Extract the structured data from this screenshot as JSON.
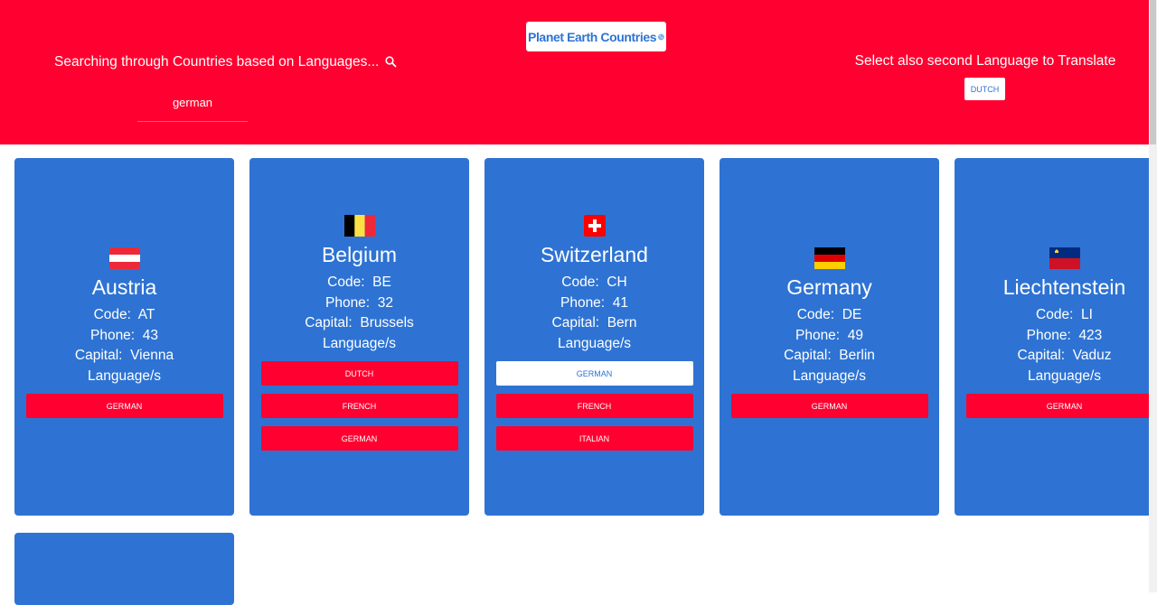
{
  "header": {
    "logo_text": "Planet Earth Countries",
    "search_title": "Searching through Countries based on Languages...",
    "search_value": "german",
    "translate_title": "Select also second Language to Translate",
    "translate_button": "DUTCH"
  },
  "labels": {
    "code": "Code:",
    "phone": "Phone:",
    "capital": "Capital:",
    "languages": "Language/s"
  },
  "countries": [
    {
      "name": "Austria",
      "code": "AT",
      "phone": "43",
      "capital": "Vienna",
      "languages": [
        "GERMAN"
      ]
    },
    {
      "name": "Belgium",
      "code": "BE",
      "phone": "32",
      "capital": "Brussels",
      "languages": [
        "DUTCH",
        "FRENCH",
        "GERMAN"
      ]
    },
    {
      "name": "Switzerland",
      "code": "CH",
      "phone": "41",
      "capital": "Bern",
      "languages": [
        "GERMAN",
        "FRENCH",
        "ITALIAN"
      ],
      "active_language": "GERMAN"
    },
    {
      "name": "Germany",
      "code": "DE",
      "phone": "49",
      "capital": "Berlin",
      "languages": [
        "GERMAN"
      ]
    },
    {
      "name": "Liechtenstein",
      "code": "LI",
      "phone": "423",
      "capital": "Vaduz",
      "languages": [
        "GERMAN"
      ]
    }
  ],
  "colors": {
    "header_bg": "#ff0030",
    "card_bg": "#2e73d3",
    "button_bg": "#ff0030",
    "button_active_bg": "#ffffff"
  }
}
